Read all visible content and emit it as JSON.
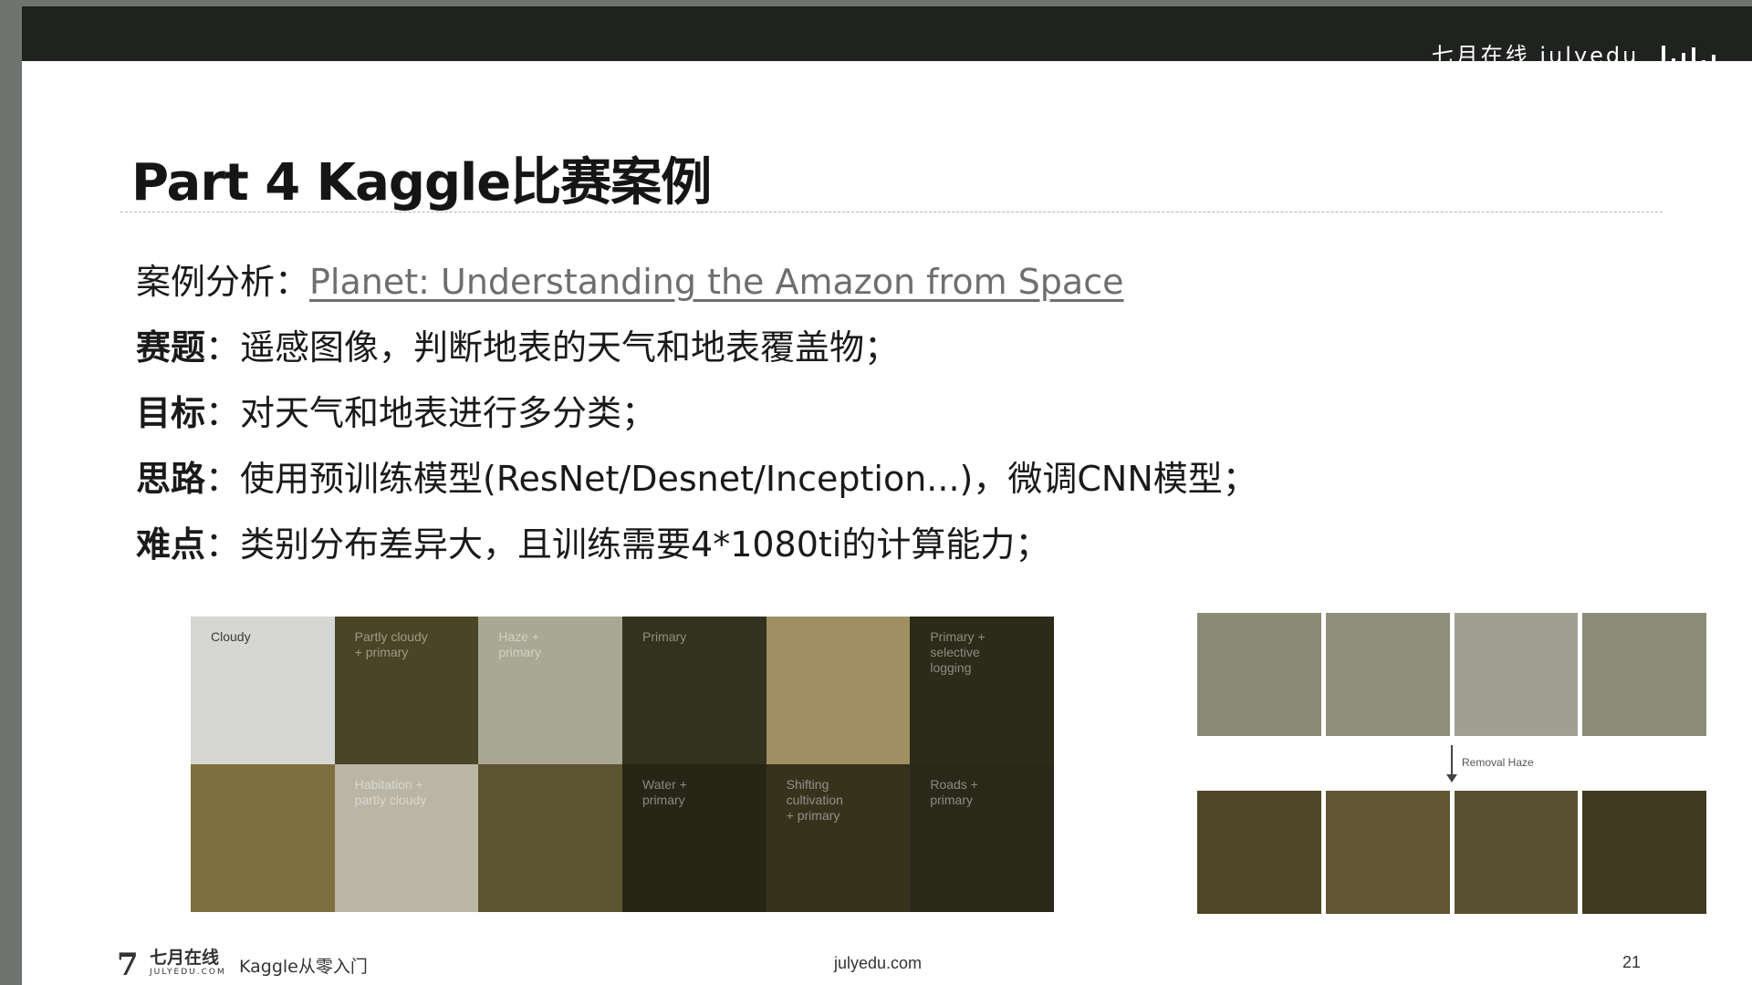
{
  "header": {
    "watermark": "七月在线 julyedu"
  },
  "slide": {
    "title": "Part 4 Kaggle比赛案例",
    "lines": [
      {
        "key": "案例分析：",
        "text": "",
        "link": "Planet: Understanding the Amazon from Space",
        "bold_key": false
      },
      {
        "key": "赛题",
        "text": "：遥感图像，判断地表的天气和地表覆盖物；",
        "link": "",
        "bold_key": true
      },
      {
        "key": "目标",
        "text": "：对天气和地表进行多分类；",
        "link": "",
        "bold_key": true
      },
      {
        "key": "思路",
        "text": "：使用预训练模型(ResNet/Desnet/Inception...)，微调CNN模型；",
        "link": "",
        "bold_key": true
      },
      {
        "key": "难点",
        "text": "：类别分布差异大，且训练需要4*1080ti的计算能力；",
        "link": "",
        "bold_key": true
      }
    ],
    "sample_tiles": [
      {
        "label": "Cloudy",
        "color": "#d6d6d2"
      },
      {
        "label": "Partly cloudy\n+ primary",
        "color": "#4a4526"
      },
      {
        "label": "Haze +\nprimary",
        "color": "#a9a894"
      },
      {
        "label": "Primary",
        "color": "#33321f"
      },
      {
        "label": "",
        "color": "#9f8f63"
      },
      {
        "label": "Primary +\nselective\nlogging",
        "color": "#2c2a19"
      },
      {
        "label": "",
        "color": "#7e6f3f"
      },
      {
        "label": "Habitation +\npartly cloudy",
        "color": "#b9b6a6"
      },
      {
        "label": "",
        "color": "#5c5330"
      },
      {
        "label": "Water +\nprimary",
        "color": "#262516"
      },
      {
        "label": "Shifting\ncultivation\n+ primary",
        "color": "#36331d"
      },
      {
        "label": "Roads +\nprimary",
        "color": "#2a2818"
      }
    ],
    "haze_tiles": [
      {
        "color": "#8b8a74"
      },
      {
        "color": "#8f8f7b"
      },
      {
        "color": "#9fa092"
      },
      {
        "color": "#8c8b77"
      }
    ],
    "arrow_label": "Removal Haze",
    "clear_tiles": [
      {
        "color": "#4e4624"
      },
      {
        "color": "#615634"
      },
      {
        "color": "#5a5130"
      },
      {
        "color": "#3f3a20"
      }
    ]
  },
  "footer": {
    "logo_mark": "7",
    "logo_cn": "七月在线",
    "logo_en": "JULYEDU.COM",
    "course": "Kaggle从零入门",
    "site": "julyedu.com",
    "page": "21"
  }
}
